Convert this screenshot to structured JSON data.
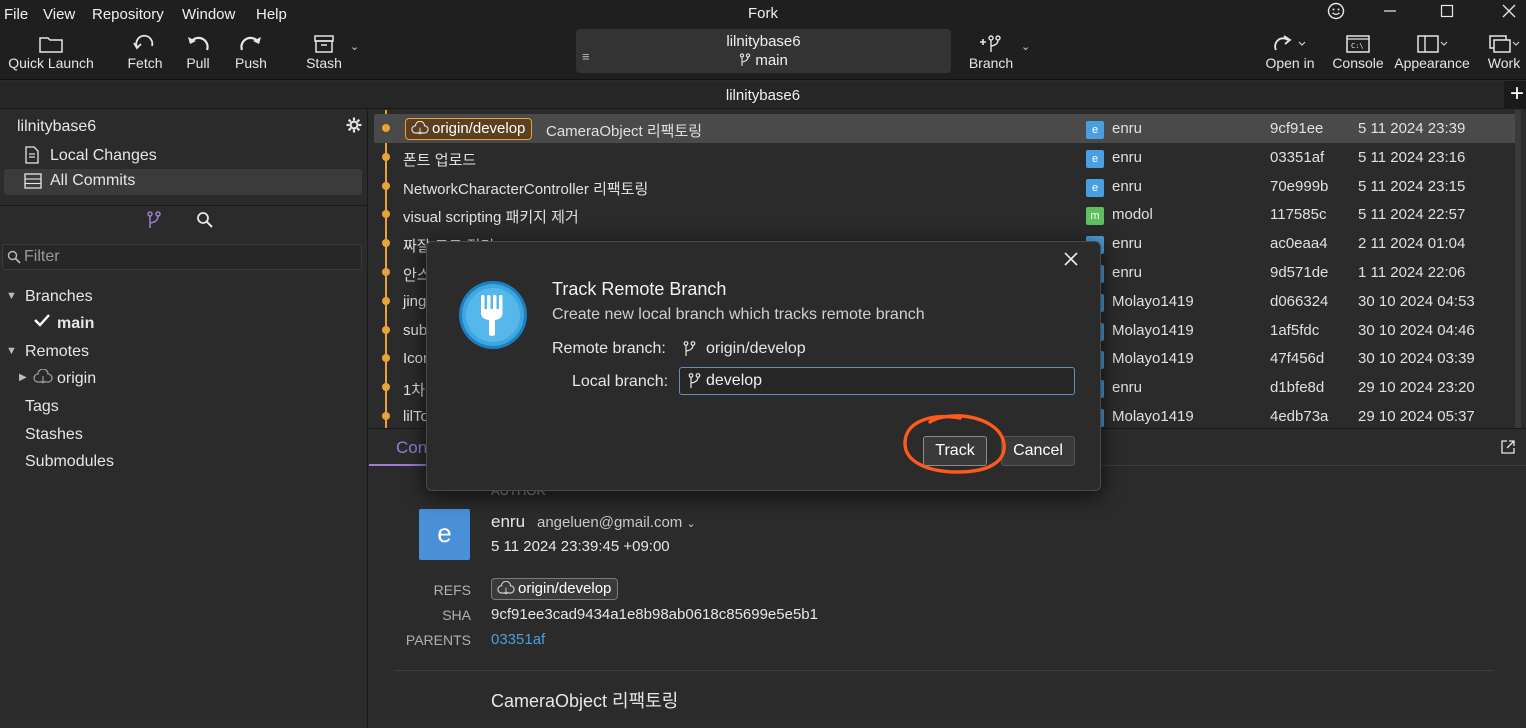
{
  "app": {
    "title": "Fork"
  },
  "menu": [
    "File",
    "View",
    "Repository",
    "Window",
    "Help"
  ],
  "toolbar": {
    "quick_launch": "Quick Launch",
    "fetch": "Fetch",
    "pull": "Pull",
    "push": "Push",
    "stash": "Stash",
    "repo_name": "lilnitybase6",
    "repo_branch": "main",
    "branch": "Branch",
    "open_in": "Open in",
    "console": "Console",
    "appearance": "Appearance",
    "work": "Work"
  },
  "tab": {
    "title": "lilnitybase6",
    "add": "+"
  },
  "sidebar": {
    "repo": "lilnitybase6",
    "local_changes": "Local Changes",
    "all_commits": "All Commits",
    "filter_placeholder": "Filter",
    "branches": "Branches",
    "current_branch": "main",
    "remotes": "Remotes",
    "remote_origin": "origin",
    "tags": "Tags",
    "stashes": "Stashes",
    "submodules": "Submodules"
  },
  "commits": [
    {
      "ref": "origin/develop",
      "message": "CameraObject 리팩토링",
      "avatar": "e",
      "avatar_color": "#4a9fe0",
      "author": "enru",
      "sha": "9cf91ee",
      "date": "5 11 2024 23:39",
      "selected": true
    },
    {
      "message": "폰트 업로드",
      "avatar": "e",
      "avatar_color": "#4a9fe0",
      "author": "enru",
      "sha": "03351af",
      "date": "5 11 2024 23:16"
    },
    {
      "message": "NetworkCharacterController 리팩토링",
      "avatar": "e",
      "avatar_color": "#4a9fe0",
      "author": "enru",
      "sha": "70e999b",
      "date": "5 11 2024 23:15"
    },
    {
      "message": "visual scripting 패키지 제거",
      "avatar": "m",
      "avatar_color": "#5fbf5f",
      "author": "modol",
      "sha": "117585c",
      "date": "5 11 2024 22:57"
    },
    {
      "message": "짜잘 코드 정리",
      "avatar": "e",
      "avatar_color": "#4a9fe0",
      "author": "enru",
      "sha": "ac0eaa4",
      "date": "2 11 2024 01:04"
    },
    {
      "message": "안스",
      "avatar": "e",
      "avatar_color": "#4a9fe0",
      "author": "enru",
      "sha": "9d571de",
      "date": "1 11 2024 22:06"
    },
    {
      "message": "jing",
      "avatar": "M",
      "avatar_color": "#4a9fe0",
      "author": "Molayo1419",
      "sha": "d066324",
      "date": "30 10 2024 04:53"
    },
    {
      "message": "sub",
      "avatar": "M",
      "avatar_color": "#4a9fe0",
      "author": "Molayo1419",
      "sha": "1af5fdc",
      "date": "30 10 2024 04:46"
    },
    {
      "message": "Icon",
      "avatar": "M",
      "avatar_color": "#4a9fe0",
      "author": "Molayo1419",
      "sha": "47f456d",
      "date": "30 10 2024 03:39"
    },
    {
      "message": "1차",
      "avatar": "e",
      "avatar_color": "#4a9fe0",
      "author": "enru",
      "sha": "d1bfe8d",
      "date": "29 10 2024 23:20"
    },
    {
      "message": "lilTo",
      "avatar": "M",
      "avatar_color": "#4a9fe0",
      "author": "Molayo1419",
      "sha": "4edb73a",
      "date": "29 10 2024 05:37"
    }
  ],
  "details": {
    "tab": "Con",
    "author_label": "AUTHOR",
    "avatar": "e",
    "author_name": "enru",
    "author_email": "angeluen@gmail.com",
    "author_date": "5 11 2024 23:39:45 +09:00",
    "refs_label": "REFS",
    "refs_value": "origin/develop",
    "sha_label": "SHA",
    "sha_value": "9cf91ee3cad9434a1e8b98ab0618c85699e5e5b1",
    "parents_label": "PARENTS",
    "parents_value": "03351af",
    "subject": "CameraObject 리팩토링"
  },
  "modal": {
    "title": "Track Remote Branch",
    "subtitle": "Create new local branch which tracks remote branch",
    "remote_label": "Remote branch:",
    "remote_value": "origin/develop",
    "local_label": "Local branch:",
    "local_value": "develop",
    "track": "Track",
    "cancel": "Cancel",
    "close": "✕"
  },
  "colors": {
    "accent": "#e8a238",
    "tab_accent": "#9b7cd6",
    "link": "#4a9fe0",
    "annotation": "#ff5a1a"
  }
}
